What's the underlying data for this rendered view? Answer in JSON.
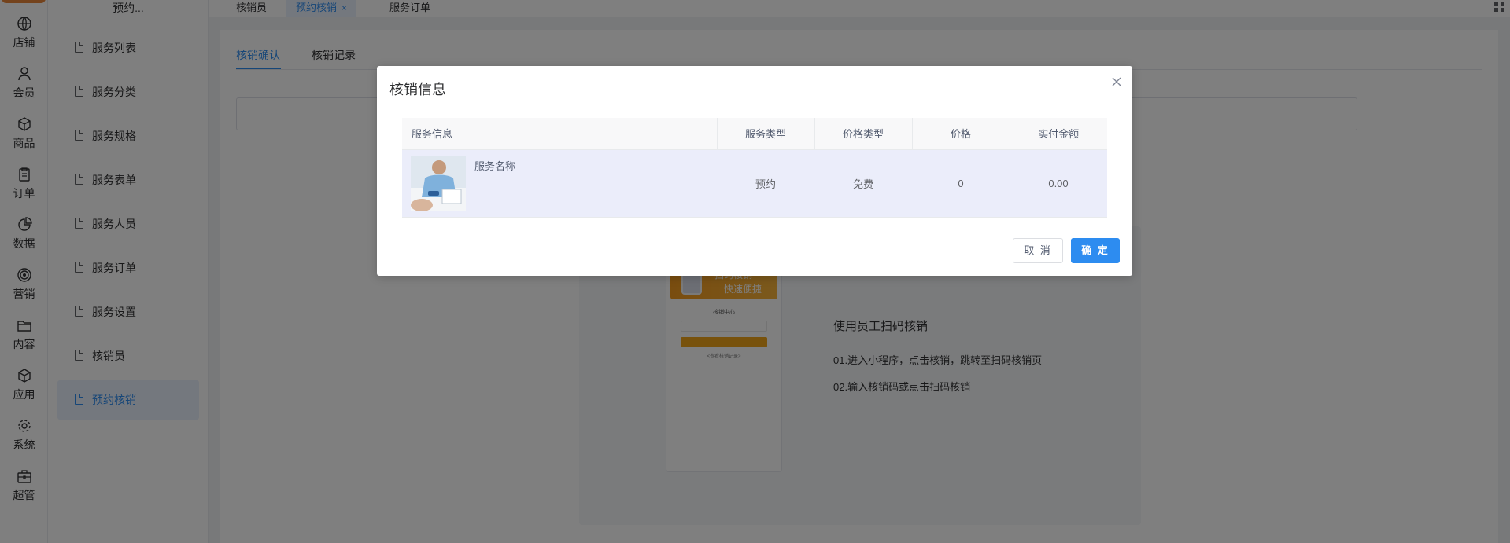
{
  "rail": {
    "items": [
      {
        "label": "店铺",
        "icon": "store-icon"
      },
      {
        "label": "会员",
        "icon": "user-icon"
      },
      {
        "label": "商品",
        "icon": "box-icon"
      },
      {
        "label": "订单",
        "icon": "clipboard-icon"
      },
      {
        "label": "数据",
        "icon": "pie-chart-icon"
      },
      {
        "label": "营销",
        "icon": "target-icon"
      },
      {
        "label": "内容",
        "icon": "folder-icon"
      },
      {
        "label": "应用",
        "icon": "cube-icon"
      },
      {
        "label": "系统",
        "icon": "gear-icon"
      },
      {
        "label": "超管",
        "icon": "toolbox-icon"
      }
    ]
  },
  "submenu": {
    "title": "预约...",
    "items": [
      {
        "label": "服务列表"
      },
      {
        "label": "服务分类"
      },
      {
        "label": "服务规格"
      },
      {
        "label": "服务表单"
      },
      {
        "label": "服务人员"
      },
      {
        "label": "服务订单"
      },
      {
        "label": "服务设置"
      },
      {
        "label": "核销员"
      },
      {
        "label": "预约核销",
        "active": true
      }
    ]
  },
  "topbar": {
    "tabs": [
      {
        "label": "核销员"
      },
      {
        "label": "预约核销",
        "active": true,
        "closable": true
      },
      {
        "label": "服务订单"
      }
    ],
    "close_glyph": "×"
  },
  "content": {
    "subtabs": [
      {
        "label": "核销确认",
        "active": true
      },
      {
        "label": "核销记录"
      }
    ],
    "guide": {
      "title": "使用员工扫码核销",
      "steps": [
        "01.进入小程序，点击核销，跳转至扫码核销页",
        "02.输入核销码或点击扫码核销"
      ],
      "phone": {
        "banner_line1": "扫码核销",
        "banner_line2": "快速便捷",
        "center_title": "核销中心",
        "link": "<查看核销记录>"
      }
    }
  },
  "modal": {
    "title": "核销信息",
    "close_glyph": "×",
    "columns": [
      "服务信息",
      "服务类型",
      "价格类型",
      "价格",
      "实付金额"
    ],
    "row": {
      "service_name": "服务名称",
      "service_type": "预约",
      "price_type": "免费",
      "price": "0",
      "paid": "0.00"
    },
    "cancel_label": "取 消",
    "ok_label": "确 定"
  },
  "colors": {
    "accent": "#2d8cf0",
    "banner": "#f39a1f"
  }
}
